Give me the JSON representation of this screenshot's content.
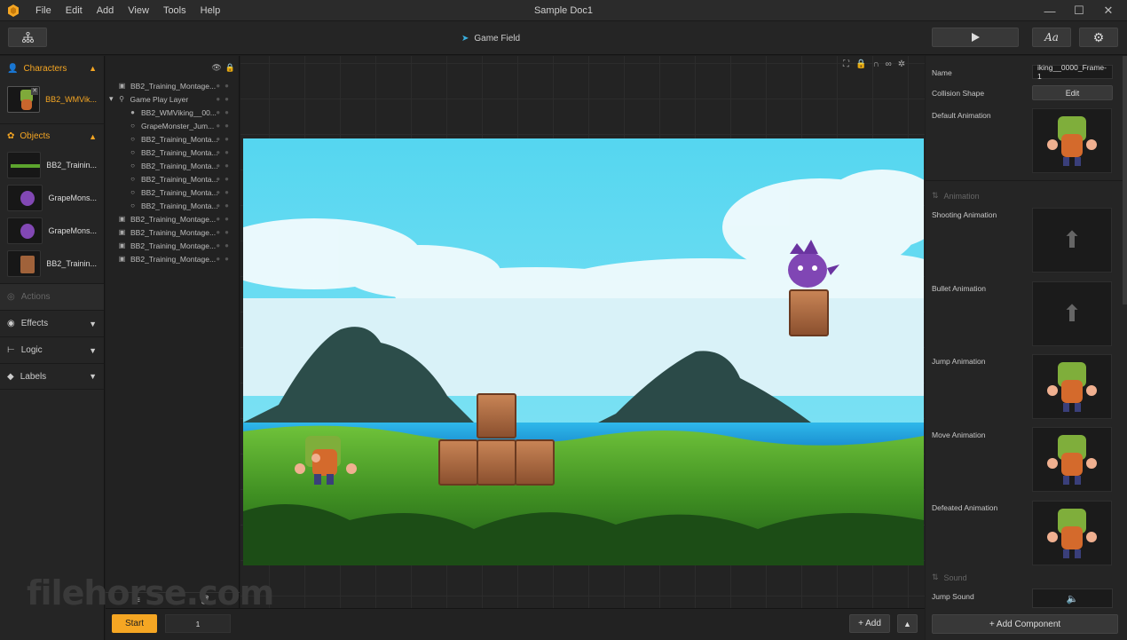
{
  "window": {
    "title": "Sample Doc1",
    "min": "—",
    "max": "☐",
    "close": "✕"
  },
  "menu": [
    "File",
    "Edit",
    "Add",
    "View",
    "Tools",
    "Help"
  ],
  "toolbar": {
    "breadcrumb": "Game Field",
    "font_button": "Aa"
  },
  "sidebar": {
    "characters_label": "Characters",
    "character_item": "BB2_WMVik...",
    "objects_label": "Objects",
    "objects": [
      "BB2_Trainin...",
      "GrapeMons...",
      "GrapeMons...",
      "BB2_Trainin..."
    ],
    "actions_label": "Actions",
    "effects_label": "Effects",
    "logic_label": "Logic",
    "labels_label": "Labels"
  },
  "layers": [
    {
      "name": "BB2_Training_Montage...",
      "indent": 0,
      "icon": "image"
    },
    {
      "name": "Game Play Layer",
      "indent": 0,
      "icon": "layer",
      "expanded": true
    },
    {
      "name": "BB2_WMViking__00...",
      "indent": 1,
      "icon": "person"
    },
    {
      "name": "GrapeMonster_Jum...",
      "indent": 1,
      "icon": "circle"
    },
    {
      "name": "BB2_Training_Monta...",
      "indent": 1,
      "icon": "circle"
    },
    {
      "name": "BB2_Training_Monta...",
      "indent": 1,
      "icon": "circle"
    },
    {
      "name": "BB2_Training_Monta...",
      "indent": 1,
      "icon": "circle"
    },
    {
      "name": "BB2_Training_Monta...",
      "indent": 1,
      "icon": "circle"
    },
    {
      "name": "BB2_Training_Monta...",
      "indent": 1,
      "icon": "circle"
    },
    {
      "name": "BB2_Training_Monta...",
      "indent": 1,
      "icon": "circle"
    },
    {
      "name": "BB2_Training_Montage...",
      "indent": 0,
      "icon": "image"
    },
    {
      "name": "BB2_Training_Montage...",
      "indent": 0,
      "icon": "image"
    },
    {
      "name": "BB2_Training_Montage...",
      "indent": 0,
      "icon": "image"
    },
    {
      "name": "BB2_Training_Montage...",
      "indent": 0,
      "icon": "image"
    }
  ],
  "properties": {
    "name_label": "Name",
    "name_value": "iking__0000_Frame-1",
    "collision_label": "Collision Shape",
    "edit_button": "Edit",
    "default_anim_label": "Default Animation",
    "animation_section": "Animation",
    "shooting_label": "Shooting Animation",
    "bullet_label": "Bullet Animation",
    "jump_label": "Jump Animation",
    "move_label": "Move Animation",
    "defeated_label": "Defeated Animation",
    "sound_section": "Sound",
    "jump_sound_label": "Jump Sound",
    "add_component": "+ Add Component"
  },
  "bottom": {
    "start_button": "Start",
    "frame_value": "1",
    "add_button": "+ Add"
  },
  "watermark": "filehorse.com",
  "colors": {
    "accent": "#f5a623",
    "panel": "#252525",
    "sky": "#5fd9ef"
  }
}
